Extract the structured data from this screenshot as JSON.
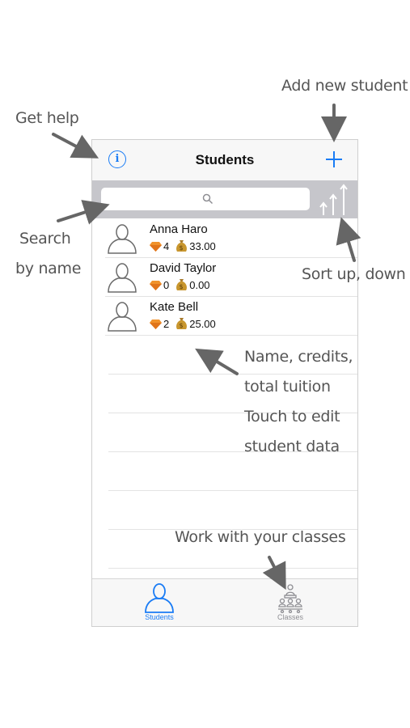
{
  "annotations": {
    "add_student": "Add new student",
    "get_help": "Get help",
    "search_line1": "Search",
    "search_line2": "by name",
    "sort": "Sort up, down",
    "row_info_line1": "Name, credits,",
    "row_info_line2": "total tuition",
    "row_info_line3": "Touch to edit",
    "row_info_line4": "student data",
    "classes": "Work with your classes"
  },
  "navbar": {
    "title": "Students"
  },
  "students": [
    {
      "name": "Anna Haro",
      "credits": "4",
      "tuition": "33.00"
    },
    {
      "name": "David Taylor",
      "credits": "0",
      "tuition": "0.00"
    },
    {
      "name": "Kate Bell",
      "credits": "2",
      "tuition": "25.00"
    }
  ],
  "tabbar": {
    "tabs": [
      {
        "label": "Students",
        "selected": true
      },
      {
        "label": "Classes",
        "selected": false
      }
    ]
  },
  "colors": {
    "accent": "#1a7cf5",
    "search_bar": "#c6c6cb",
    "annotation": "#555555"
  },
  "icons": [
    "info-icon",
    "plus-icon",
    "search-icon",
    "sort-icon",
    "avatar-icon",
    "diamond-icon",
    "money-bag-icon",
    "classes-icon"
  ]
}
